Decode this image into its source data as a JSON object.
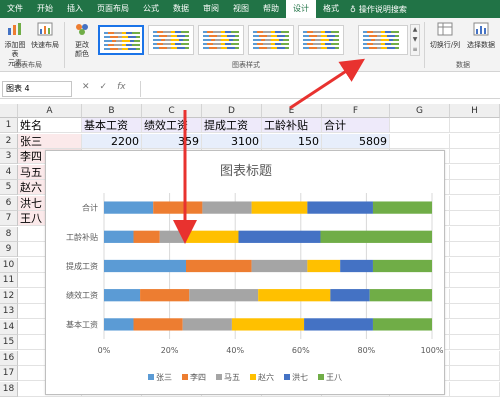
{
  "ribbon": {
    "tabs": [
      "文件",
      "开始",
      "插入",
      "页面布局",
      "公式",
      "数据",
      "审阅",
      "视图",
      "帮助",
      "设计",
      "格式"
    ],
    "active_tab": "设计",
    "search_label": "操作说明搜索",
    "buttons": {
      "add_element": "添加图表\n元素",
      "quick_layout": "快速布局",
      "change_colors": "更改\n颜色",
      "switch_row_col": "切换行/列",
      "select_data": "选择数据"
    },
    "groups": {
      "layouts": "图表布局",
      "styles": "图表样式",
      "data": "数据"
    }
  },
  "formula_bar": {
    "name_box": "图表 4",
    "cancel_icon": "✕",
    "enter_icon": "✓",
    "fx": "fx"
  },
  "sheet": {
    "columns": [
      "A",
      "B",
      "C",
      "D",
      "E",
      "F",
      "G",
      "H"
    ],
    "rows": [
      "1",
      "2",
      "3",
      "4",
      "5",
      "6",
      "7",
      "8",
      "9",
      "10",
      "11",
      "12",
      "13",
      "14",
      "15",
      "16",
      "17",
      "18"
    ],
    "header_row": [
      "姓名",
      "基本工资",
      "绩效工资",
      "提成工资",
      "工龄补贴",
      "合计"
    ],
    "row2": [
      "张三",
      "2200",
      "359",
      "3100",
      "150",
      "5809"
    ],
    "names": [
      "李四",
      "马五",
      "赵六",
      "洪七",
      "王八"
    ]
  },
  "chart_data": {
    "type": "bar",
    "stacked": "percent",
    "orientation": "horizontal",
    "title": "图表标题",
    "categories": [
      "基本工资",
      "绩效工资",
      "提成工资",
      "工龄补贴",
      "合计"
    ],
    "series": [
      {
        "name": "张三",
        "values": [
          9,
          11,
          25,
          9,
          15
        ],
        "color": "#5b9bd5"
      },
      {
        "name": "李四",
        "values": [
          15,
          15,
          20,
          8,
          15
        ],
        "color": "#ed7d31"
      },
      {
        "name": "马五",
        "values": [
          15,
          21,
          17,
          8,
          15
        ],
        "color": "#a5a5a5"
      },
      {
        "name": "赵六",
        "values": [
          22,
          22,
          10,
          16,
          17
        ],
        "color": "#ffc000"
      },
      {
        "name": "洪七",
        "values": [
          21,
          12,
          10,
          25,
          20
        ],
        "color": "#4472c4"
      },
      {
        "name": "王八",
        "values": [
          18,
          19,
          18,
          34,
          18
        ],
        "color": "#70ad47"
      }
    ],
    "xticks": [
      "0%",
      "20%",
      "40%",
      "60%",
      "80%",
      "100%"
    ],
    "xlim": [
      0,
      100
    ],
    "grid": true,
    "legend": "bottom"
  }
}
